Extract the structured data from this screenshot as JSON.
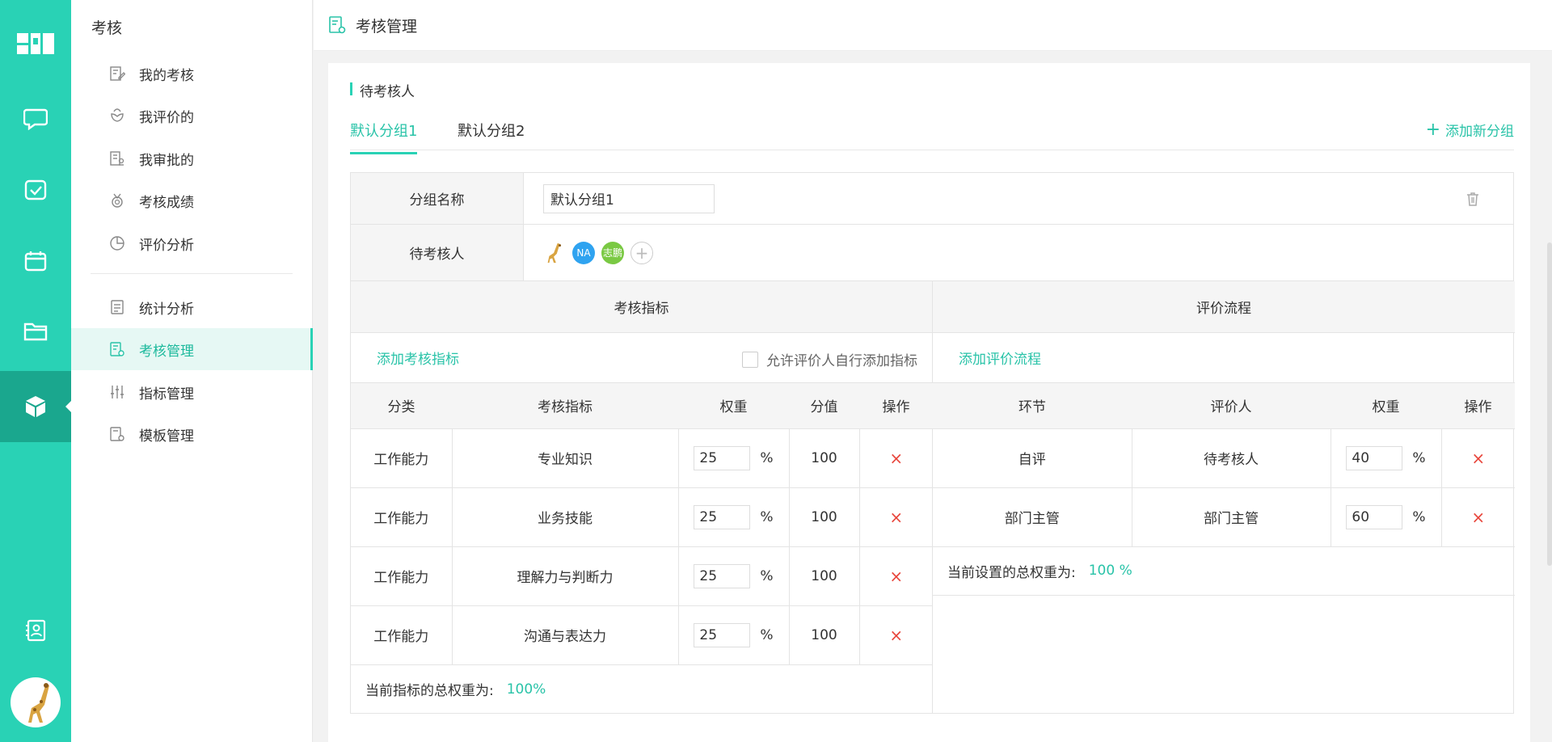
{
  "sidebar": {
    "title": "考核",
    "items": [
      {
        "label": "我的考核",
        "icon": "edit-doc-icon"
      },
      {
        "label": "我评价的",
        "icon": "flower-icon"
      },
      {
        "label": "我审批的",
        "icon": "approve-doc-icon"
      },
      {
        "label": "考核成绩",
        "icon": "medal-icon"
      },
      {
        "label": "评价分析",
        "icon": "pie-chart-icon"
      },
      {
        "label": "统计分析",
        "icon": "stats-doc-icon"
      },
      {
        "label": "考核管理",
        "icon": "settings-doc-icon",
        "active": true
      },
      {
        "label": "指标管理",
        "icon": "sliders-icon"
      },
      {
        "label": "模板管理",
        "icon": "template-settings-icon"
      }
    ]
  },
  "header": {
    "title": "考核管理"
  },
  "section": {
    "title": "待考核人",
    "tabs": [
      "默认分组1",
      "默认分组2"
    ],
    "add_group_label": "添加新分组"
  },
  "group": {
    "name_label": "分组名称",
    "name_value": "默认分组1",
    "reviewees_label": "待考核人",
    "avatars": [
      "NA",
      "志鹏"
    ]
  },
  "indicators": {
    "title": "考核指标",
    "add_label": "添加考核指标",
    "allow_label": "允许评价人自行添加指标",
    "columns": [
      "分类",
      "考核指标",
      "权重",
      "分值",
      "操作"
    ],
    "rows": [
      {
        "category": "工作能力",
        "name": "专业知识",
        "weight": "25",
        "score": "100"
      },
      {
        "category": "工作能力",
        "name": "业务技能",
        "weight": "25",
        "score": "100"
      },
      {
        "category": "工作能力",
        "name": "理解力与判断力",
        "weight": "25",
        "score": "100"
      },
      {
        "category": "工作能力",
        "name": "沟通与表达力",
        "weight": "25",
        "score": "100"
      }
    ],
    "total_label": "当前指标的总权重为:",
    "total_value": "100%"
  },
  "process": {
    "title": "评价流程",
    "add_label": "添加评价流程",
    "columns": [
      "环节",
      "评价人",
      "权重",
      "操作"
    ],
    "rows": [
      {
        "stage": "自评",
        "reviewer": "待考核人",
        "weight": "40"
      },
      {
        "stage": "部门主管",
        "reviewer": "部门主管",
        "weight": "60"
      }
    ],
    "total_label": "当前设置的总权重为:",
    "total_value": "100 %"
  },
  "symbols": {
    "percent": "%",
    "delete": "×",
    "plus": "+"
  },
  "colors": {
    "accent": "#29d2b5",
    "rail_active": "#1aa78e",
    "delete": "#e8463c"
  }
}
